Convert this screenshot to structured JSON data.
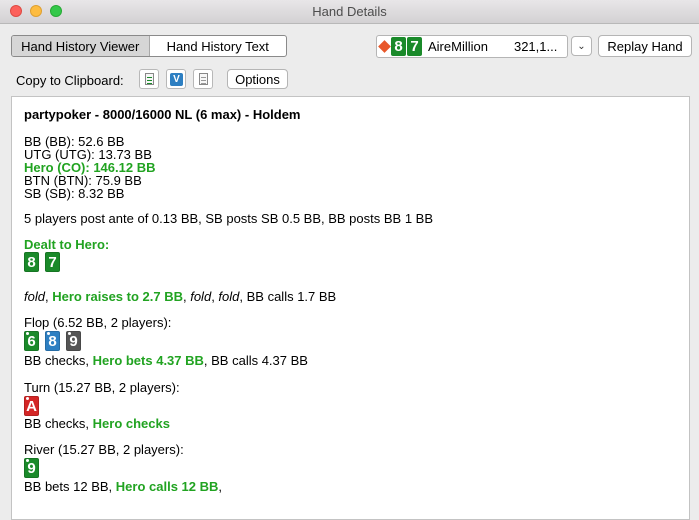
{
  "window": {
    "title": "Hand Details"
  },
  "tabs": [
    {
      "label": "Hand History Viewer",
      "active": true
    },
    {
      "label": "Hand History Text",
      "active": false
    }
  ],
  "player_selector": {
    "cards": [
      "8",
      "7"
    ],
    "name": "AireMillion",
    "chips": "321,1...",
    "dealer_icon": "dealer-button-icon"
  },
  "buttons": {
    "replay": "Replay Hand",
    "options": "Options",
    "dropdown_icon": "chevron-down-icon"
  },
  "clipboard": {
    "label": "Copy to Clipboard:",
    "icons": [
      "copy-text-icon",
      "copy-holdem-manager-icon",
      "copy-plain-icon"
    ]
  },
  "colors": {
    "hero": "#21a321",
    "card_green": "#1a8a2a",
    "card_blue": "#2d7fc2",
    "card_gray": "#555555",
    "card_red": "#d42626"
  },
  "hand": {
    "header": "partypoker - 8000/16000 NL (6 max) - Holdem",
    "stacks": [
      {
        "text": "BB (BB): 52.6 BB",
        "hero": false
      },
      {
        "text": "UTG (UTG): 13.73 BB",
        "hero": false
      },
      {
        "text": "Hero (CO): 146.12 BB",
        "hero": true
      },
      {
        "text": "BTN (BTN): 75.9 BB",
        "hero": false
      },
      {
        "text": "SB (SB): 8.32 BB",
        "hero": false
      }
    ],
    "antes": "5 players post ante of 0.13 BB, SB posts SB 0.5 BB, BB posts BB 1 BB",
    "dealt_label": "Dealt to Hero:",
    "hero_cards": [
      {
        "rank": "8",
        "suit": "clubs"
      },
      {
        "rank": "7",
        "suit": "clubs"
      }
    ],
    "preflop": {
      "a1": "fold",
      "sep1": ", ",
      "a2": "Hero raises to 2.7 BB",
      "sep2": ", ",
      "a3": "fold",
      "sep3": ", ",
      "a4": "fold",
      "sep4": ", ",
      "a5": "BB calls 1.7 BB"
    },
    "flop": {
      "label": "Flop (6.52 BB, 2 players):",
      "cards": [
        {
          "rank": "6",
          "suit": "clubs"
        },
        {
          "rank": "8",
          "suit": "diamonds"
        },
        {
          "rank": "9",
          "suit": "spades"
        }
      ],
      "a1": "BB checks, ",
      "a2": "Hero bets 4.37 BB",
      "a3": ", BB calls 4.37 BB"
    },
    "turn": {
      "label": "Turn (15.27 BB, 2 players):",
      "cards": [
        {
          "rank": "A",
          "suit": "hearts"
        }
      ],
      "a1": "BB checks, ",
      "a2": "Hero checks"
    },
    "river": {
      "label": "River (15.27 BB, 2 players):",
      "cards": [
        {
          "rank": "9",
          "suit": "clubs"
        }
      ],
      "a1": "BB bets 12 BB, ",
      "a2": "Hero calls 12 BB",
      "a3": ","
    }
  }
}
